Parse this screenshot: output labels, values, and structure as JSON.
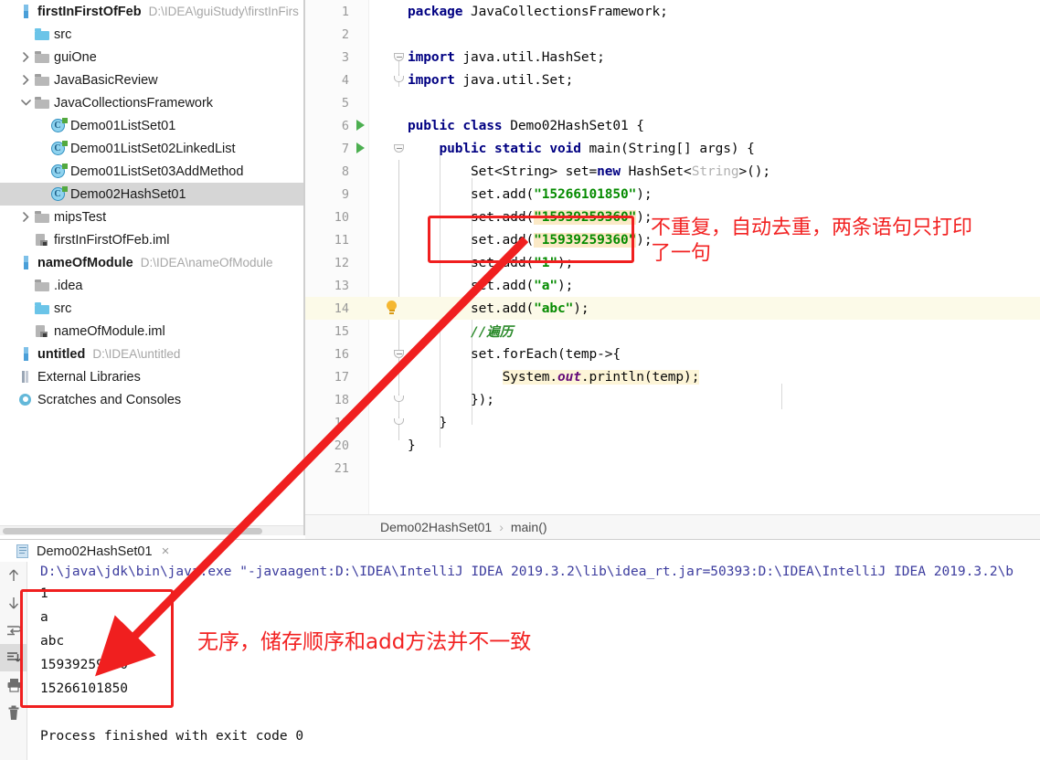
{
  "project": {
    "tree": [
      {
        "label": "firstInFirstOfFeb",
        "path": "D:\\IDEA\\guiStudy\\firstInFirs",
        "icon": "module-icon",
        "kind": "module",
        "indent": 0,
        "arrow": "",
        "bold": true
      },
      {
        "label": "src",
        "path": "",
        "icon": "folder-blue-icon",
        "kind": "folder",
        "indent": 1,
        "arrow": "",
        "bold": false
      },
      {
        "label": "guiOne",
        "path": "",
        "icon": "folder-gray-icon",
        "kind": "folder",
        "indent": 1,
        "arrow": "collapsed",
        "bold": false
      },
      {
        "label": "JavaBasicReview",
        "path": "",
        "icon": "folder-gray-icon",
        "kind": "folder",
        "indent": 1,
        "arrow": "collapsed",
        "bold": false
      },
      {
        "label": "JavaCollectionsFramework",
        "path": "",
        "icon": "folder-gray-icon",
        "kind": "folder",
        "indent": 1,
        "arrow": "expanded",
        "bold": false
      },
      {
        "label": "Demo01ListSet01",
        "path": "",
        "icon": "java-class-icon",
        "kind": "class",
        "indent": 2,
        "arrow": "",
        "bold": false
      },
      {
        "label": "Demo01ListSet02LinkedList",
        "path": "",
        "icon": "java-class-icon",
        "kind": "class",
        "indent": 2,
        "arrow": "",
        "bold": false
      },
      {
        "label": "Demo01ListSet03AddMethod",
        "path": "",
        "icon": "java-class-icon",
        "kind": "class",
        "indent": 2,
        "arrow": "",
        "bold": false
      },
      {
        "label": "Demo02HashSet01",
        "path": "",
        "icon": "java-class-icon",
        "kind": "class",
        "indent": 2,
        "arrow": "",
        "bold": false,
        "selected": true
      },
      {
        "label": "mipsTest",
        "path": "",
        "icon": "folder-gray-icon",
        "kind": "folder",
        "indent": 1,
        "arrow": "collapsed",
        "bold": false
      },
      {
        "label": "firstInFirstOfFeb.iml",
        "path": "",
        "icon": "iml-file-icon",
        "kind": "iml",
        "indent": 1,
        "arrow": "",
        "bold": false
      },
      {
        "label": "nameOfModule",
        "path": "D:\\IDEA\\nameOfModule",
        "icon": "module-icon",
        "kind": "module",
        "indent": 0,
        "arrow": "",
        "bold": true
      },
      {
        "label": ".idea",
        "path": "",
        "icon": "folder-gray-icon",
        "kind": "folder",
        "indent": 1,
        "arrow": "",
        "bold": false
      },
      {
        "label": "src",
        "path": "",
        "icon": "folder-blue-icon",
        "kind": "folder",
        "indent": 1,
        "arrow": "",
        "bold": false
      },
      {
        "label": "nameOfModule.iml",
        "path": "",
        "icon": "iml-file-icon",
        "kind": "iml",
        "indent": 1,
        "arrow": "",
        "bold": false
      },
      {
        "label": "untitled",
        "path": "D:\\IDEA\\untitled",
        "icon": "module-icon",
        "kind": "module",
        "indent": 0,
        "arrow": "",
        "bold": true
      },
      {
        "label": "External Libraries",
        "path": "",
        "icon": "external-libraries-icon",
        "kind": "lib",
        "indent": 0,
        "arrow": "",
        "bold": false
      },
      {
        "label": "Scratches and Consoles",
        "path": "",
        "icon": "scratches-icon",
        "kind": "scratch",
        "indent": 0,
        "arrow": "",
        "bold": false
      }
    ]
  },
  "editor": {
    "lines": [
      {
        "n": "1",
        "indent": 0,
        "html": "<span class=\"kw\">package</span> JavaCollectionsFramework;"
      },
      {
        "n": "2",
        "indent": 0,
        "html": ""
      },
      {
        "n": "3",
        "indent": 0,
        "html": "<span class=\"kw\">import</span> java.util.HashSet;"
      },
      {
        "n": "4",
        "indent": 0,
        "html": "<span class=\"kw\">import</span> java.util.Set;"
      },
      {
        "n": "5",
        "indent": 0,
        "html": ""
      },
      {
        "n": "6",
        "indent": 0,
        "html": "<span class=\"kw\">public class</span> Demo02HashSet01 {"
      },
      {
        "n": "7",
        "indent": 0,
        "html": "    <span class=\"kw\">public static void</span> main(String[] args) {"
      },
      {
        "n": "8",
        "indent": 0,
        "html": "        Set&lt;String&gt; set=<span class=\"kw\">new</span> HashSet&lt;<span class=\"gray\">String</span>&gt;();"
      },
      {
        "n": "9",
        "indent": 0,
        "html": "        set.add(<span class=\"str\">\"15266101850\"</span>);"
      },
      {
        "n": "10",
        "indent": 0,
        "html": "        set.add(<span class=\"str hl-peach\">\"15939259360\"</span>);"
      },
      {
        "n": "11",
        "indent": 0,
        "html": "        set.add(<span class=\"str hl-peach\">\"15939259360\"</span>);"
      },
      {
        "n": "12",
        "indent": 0,
        "html": "        set.add(<span class=\"str\">\"1\"</span>);"
      },
      {
        "n": "13",
        "indent": 0,
        "html": "        set.add(<span class=\"str\">\"a\"</span>);"
      },
      {
        "n": "14",
        "indent": 0,
        "html": "        set.add(<span class=\"str\">\"abc\"</span>);",
        "current": true
      },
      {
        "n": "15",
        "indent": 0,
        "html": "        <span class=\"cmt-green\">//遍历</span>"
      },
      {
        "n": "16",
        "indent": 0,
        "html": "        set.forEach(temp-&gt;{"
      },
      {
        "n": "17",
        "indent": 0,
        "html": "            <span class=\"hl-yellow\">System.<span class=\"ital-purple\">out</span>.println(temp);</span>"
      },
      {
        "n": "18",
        "indent": 0,
        "html": "        });"
      },
      {
        "n": "19",
        "indent": 0,
        "html": "    }"
      },
      {
        "n": "20",
        "indent": 0,
        "html": "}"
      },
      {
        "n": "21",
        "indent": 0,
        "html": ""
      }
    ],
    "code_plain": [
      "package JavaCollectionsFramework;",
      "",
      "import java.util.HashSet;",
      "import java.util.Set;",
      "",
      "public class Demo02HashSet01 {",
      "    public static void main(String[] args) {",
      "        Set<String> set=new HashSet<String>();",
      "        set.add(\"15266101850\");",
      "        set.add(\"15939259360\");",
      "        set.add(\"15939259360\");",
      "        set.add(\"1\");",
      "        set.add(\"a\");",
      "        set.add(\"abc\");",
      "        //遍历",
      "        set.forEach(temp->{",
      "            System.out.println(temp);",
      "        });",
      "    }",
      "}",
      ""
    ],
    "run_marker_lines": [
      "6",
      "7"
    ],
    "current_line": "14",
    "breadcrumb": {
      "class_name": "Demo02HashSet01",
      "separator": "›",
      "method_name": "main()"
    }
  },
  "console": {
    "tab_label": "Demo02HashSet01",
    "close_label": "×",
    "command_line": "D:\\java\\jdk\\bin\\java.exe \"-javaagent:D:\\IDEA\\IntelliJ IDEA 2019.3.2\\lib\\idea_rt.jar=50393:D:\\IDEA\\IntelliJ IDEA 2019.3.2\\b",
    "output_lines": [
      "1",
      "a",
      "abc",
      "15939259360",
      "15266101850"
    ],
    "exit_line": "Process finished with exit code 0",
    "toolbar_icons": [
      "arrow-up-icon",
      "arrow-down-icon",
      "soft-wrap-icon",
      "scroll-to-end-icon",
      "print-icon",
      "trash-icon"
    ]
  },
  "annotations": {
    "color": "#f22222",
    "code_note": "不重复，自动去重，两条语句只打印\n了一句",
    "console_note": "无序，储存顺序和add方法并不一致"
  }
}
